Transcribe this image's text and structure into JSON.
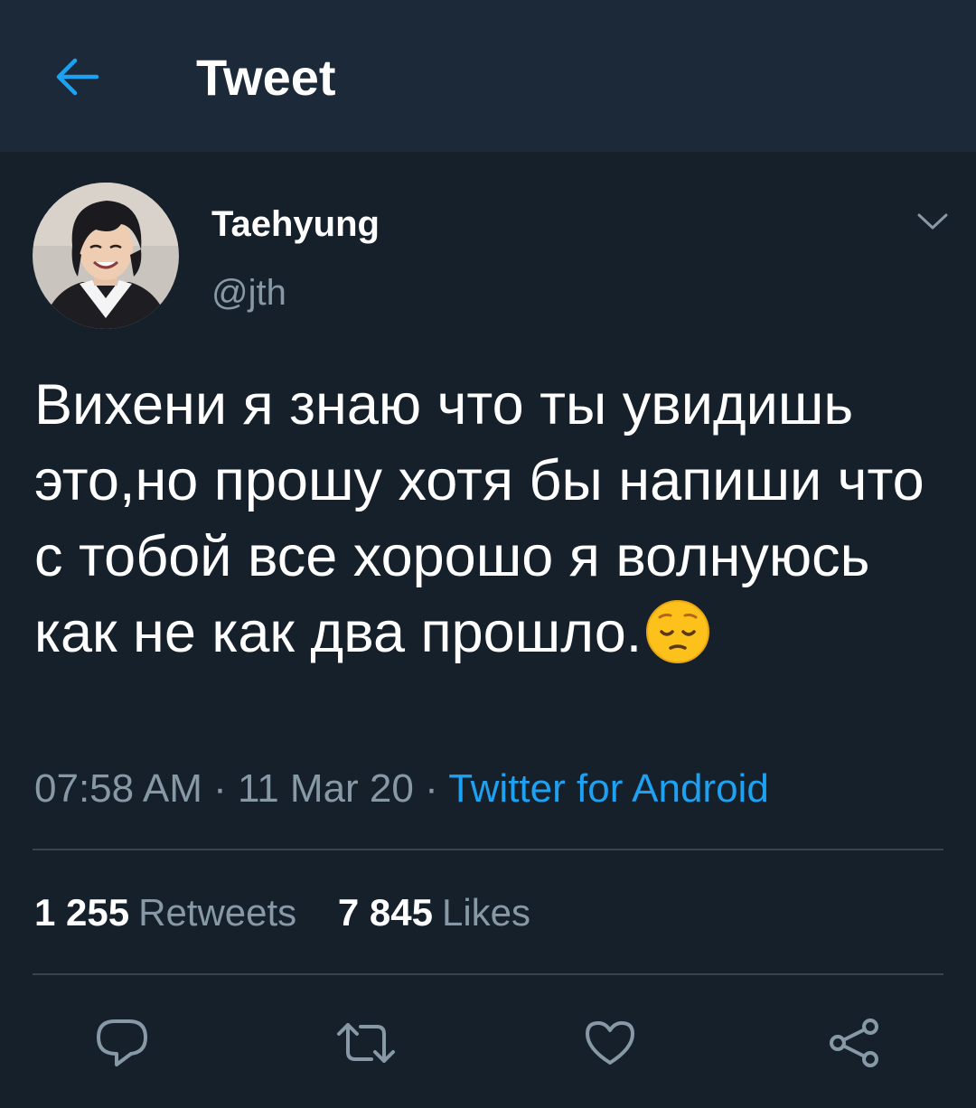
{
  "header": {
    "back_icon": "arrow-left-icon",
    "title": "Tweet"
  },
  "tweet": {
    "author": {
      "display_name": "Taehyung",
      "handle": "@jth",
      "avatar": "avatar-photo"
    },
    "more_icon": "chevron-down-icon",
    "text": "Вихени я знаю что ты увидишь это,но прошу хотя бы напиши что с тобой все хорошо я волнуюсь как не как два прошло.",
    "emoji": "pensive-face-emoji",
    "time": "07:58 AM",
    "date": "11 Mar 20",
    "separator": "·",
    "source": "Twitter for Android",
    "stats": {
      "retweets_count": "1 255",
      "retweets_label": "Retweets",
      "likes_count": "7 845",
      "likes_label": "Likes"
    },
    "actions": [
      "reply-icon",
      "retweet-icon",
      "like-icon",
      "share-icon"
    ]
  },
  "colors": {
    "background": "#15202b",
    "header_background": "#1c2938",
    "accent": "#1da1f2",
    "secondary_text": "#8899a6",
    "divider": "#38444d"
  }
}
